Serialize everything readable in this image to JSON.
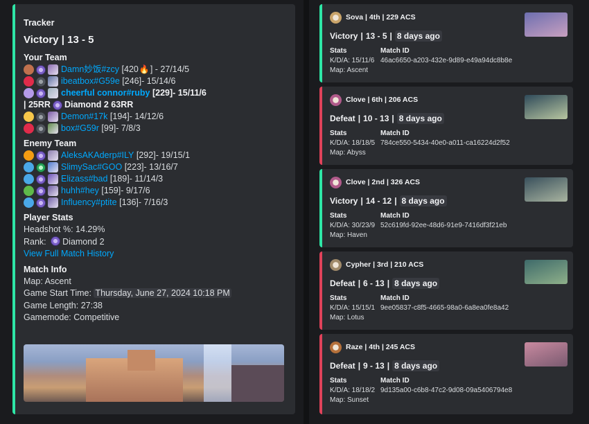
{
  "tracker": {
    "title": "Tracker",
    "result": "Victory | 13 - 5",
    "your_team_label": "Your Team",
    "your_team": [
      {
        "dot": "#c0714e",
        "name": "Damn妙饭#zcy",
        "acs": "[420",
        "fire": true,
        "after": "] - 27/14/5",
        "bold": false,
        "agent": "#8a6bb0",
        "rank": "normal"
      },
      {
        "dot": "#e02b4a",
        "name": "ibeatbox#G59e",
        "acs": "[246]",
        "fire": false,
        "after": " - 15/14/6",
        "bold": false,
        "agent": "#5a6fa0",
        "rank": "unr"
      },
      {
        "dot": "#b49ae8",
        "name": "cheerful connor#ruby",
        "acs": "[229]",
        "fire": false,
        "after": " - 15/11/6",
        "bold": true,
        "agent": "#a0b4c0",
        "rank": "normal"
      },
      {
        "dot": "#f6c64a",
        "name": "Demon#17k",
        "acs": "[194]",
        "fire": false,
        "after": " - 14/12/6",
        "bold": false,
        "agent": "#7b5aa6",
        "rank": "unr"
      },
      {
        "dot": "#e02b4a",
        "name": "box#G59r",
        "acs": "[99]",
        "fire": false,
        "after": " - 7/8/3",
        "bold": false,
        "agent": "#5f8a4a",
        "rank": "unr"
      }
    ],
    "rr_line": {
      "prefix": "| 25RR",
      "rank": "Diamond 2 63RR"
    },
    "enemy_team_label": "Enemy Team",
    "enemy_team": [
      {
        "dot": "#f39c12",
        "name": "AleksAKAderp#ILY",
        "acs": "[292]",
        "after": " - 19/15/1",
        "agent": "#8d7fb0",
        "rank": "normal"
      },
      {
        "dot": "#4aa8e8",
        "name": "SlimySac#GOO",
        "acs": "[223]",
        "after": " - 13/16/7",
        "agent": "#4f7bd0",
        "rank": "asc"
      },
      {
        "dot": "#4aa8e8",
        "name": "Elizass#bad",
        "acs": "[189]",
        "after": " - 11/14/3",
        "agent": "#6a4fb8",
        "rank": "normal"
      },
      {
        "dot": "#5fb94a",
        "name": "huhh#hey",
        "acs": "[159]",
        "after": " - 9/17/6",
        "agent": "#6b5aa0",
        "rank": "normal"
      },
      {
        "dot": "#4aa8e8",
        "name": "Influency#ptite",
        "acs": "[136]",
        "after": " - 7/16/3",
        "agent": "#7060a8",
        "rank": "normal"
      }
    ],
    "player_stats_label": "Player Stats",
    "headshot": "Headshot %: 14.29%",
    "rank_label": "Rank:",
    "rank_value": "Diamond 2",
    "history_link": "View Full Match History",
    "match_info_label": "Match Info",
    "map": "Map: Ascent",
    "start_label": "Game Start Time:",
    "start_value": "Thursday, June 27, 2024 10:18 PM",
    "length": "Game Length: 27:38",
    "mode": "Gamemode: Competitive"
  },
  "matches": [
    {
      "agent_color": "#c9a46a",
      "header": "Sova | 4th | 229 ACS",
      "result": "Victory",
      "score": "13 - 5",
      "ago": "8 days ago",
      "kda": "K/D/A: 15/11/6",
      "id": "46ac6650-a203-432e-9d89-e49a94dc8b8e",
      "map": "Map: Ascent",
      "win": true,
      "thumb": [
        "#6d6fb0",
        "#c9a0c0"
      ]
    },
    {
      "agent_color": "#b05a8a",
      "header": "Clove | 6th | 206 ACS",
      "result": "Defeat",
      "score": "10 - 13",
      "ago": "8 days ago",
      "kda": "K/D/A: 18/18/5",
      "id": "784ce550-5434-40e0-a011-ca16224d2f52",
      "map": "Map: Abyss",
      "win": false,
      "thumb": [
        "#2f4a5a",
        "#b8c6a0"
      ]
    },
    {
      "agent_color": "#b05a8a",
      "header": "Clove | 2nd | 326 ACS",
      "result": "Victory",
      "score": "14 - 12",
      "ago": "8 days ago",
      "kda": "K/D/A: 30/23/9",
      "id": "52c619fd-92ee-48d6-91e9-7416df3f21eb",
      "map": "Map: Haven",
      "win": true,
      "thumb": [
        "#39505c",
        "#a9b4a0"
      ]
    },
    {
      "agent_color": "#a08a6a",
      "header": "Cypher | 3rd | 210 ACS",
      "result": "Defeat",
      "score": "6 - 13",
      "ago": "8 days ago",
      "kda": "K/D/A: 15/15/1",
      "id": "9ee05837-c8f5-4665-98a0-6a8ea0fe8a42",
      "map": "Map: Lotus",
      "win": false,
      "thumb": [
        "#3e6a6a",
        "#8fb08a"
      ]
    },
    {
      "agent_color": "#b5703a",
      "header": "Raze | 4th | 245 ACS",
      "result": "Defeat",
      "score": "9 - 13",
      "ago": "8 days ago",
      "kda": "K/D/A: 18/18/2",
      "id": "9d135a00-c6b8-47c2-9d08-09a5406794e8",
      "map": "Map: Sunset",
      "win": false,
      "thumb": [
        "#c98aa0",
        "#7a5a70"
      ]
    }
  ],
  "labels": {
    "stats": "Stats",
    "match_id": "Match ID"
  },
  "colors": {
    "win": "#2ee6a6",
    "loss": "#e0425a",
    "link": "#00a8fc"
  }
}
